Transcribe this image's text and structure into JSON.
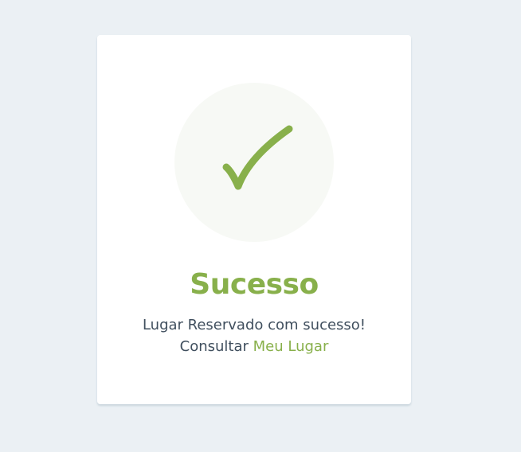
{
  "card": {
    "icon": "checkmark-icon",
    "title": "Sucesso",
    "message_line1": "Lugar Reservado com sucesso!",
    "message_prefix": "Consultar",
    "link_text": "Meu Lugar"
  },
  "colors": {
    "background": "#ebf0f4",
    "card": "#ffffff",
    "icon_circle": "#f7f9f5",
    "accent": "#88b04b",
    "text": "#404f5e"
  }
}
